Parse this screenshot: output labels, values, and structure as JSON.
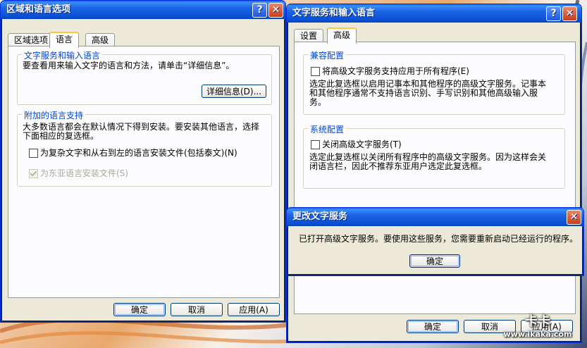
{
  "win_left": {
    "title": "区域和语言选项",
    "help_glyph": "?",
    "close_glyph": "✕",
    "tabs": [
      "区域选项",
      "语言",
      "高级"
    ],
    "group1": {
      "title": "文字服务和输入语言",
      "desc": "要查看用来输入文字的语言和方法，请单击“详细信息”。",
      "details_button": "详细信息(D)..."
    },
    "group2": {
      "title": "附加的语言支持",
      "desc_line1": "大多数语言都会在默认情况下得到安装。要安装其他语言，选择",
      "desc_line2": "下面相应的复选框。",
      "cb1_label": "为复杂文字和从右到左的语言安装文件(包括泰文)(N)",
      "cb2_label": "为东亚语言安装文件(S)"
    },
    "ok_button": "确定",
    "cancel_button": "取消",
    "apply_button": "应用(A)"
  },
  "win_right": {
    "title": "文字服务和输入语言",
    "help_glyph": "?",
    "close_glyph": "✕",
    "tabs": [
      "设置",
      "高级"
    ],
    "group1": {
      "title": "兼容配置",
      "cb_label": "将高级文字服务支持应用于所有程序(E)",
      "desc_line1": "选定此复选框以启用记事本和其他程序的高级文字服务。记事本",
      "desc_line2": "和其他程序通常不支持语言识别、手写识别和其他高级输入服",
      "desc_line3": "务。"
    },
    "group2": {
      "title": "系统配置",
      "cb_label": "关闭高级文字服务(T)",
      "desc_line1": "选定此复选框以关闭所有程序中的高级文字服务。因为这样会关",
      "desc_line2": "闭语言栏，因此不推荐东亚用户选定此复选框。"
    },
    "ok_button": "确定",
    "cancel_button": "取消",
    "apply_button": "应用(A)"
  },
  "dialog": {
    "title": "更改文字服务",
    "close_glyph": "✕",
    "message": "已打开高级文字服务。要使用这些服务，您需要重新启动已经运行的程序。",
    "ok_button": "确定"
  },
  "watermark": {
    "brand": "卡卡",
    "url": "www.ikaka.com"
  }
}
